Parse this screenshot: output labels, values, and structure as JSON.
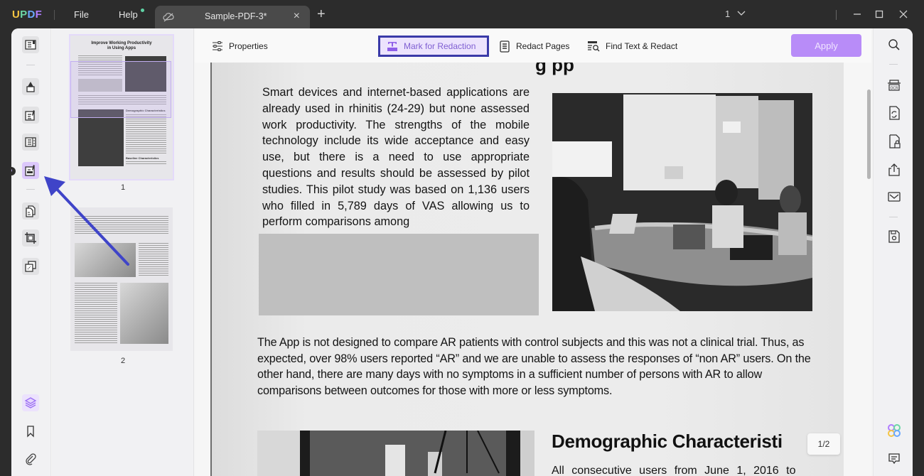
{
  "app": {
    "logo": "UPDF",
    "logo_letters": [
      "U",
      "P",
      "D",
      "F"
    ]
  },
  "menu": {
    "file": "File",
    "help": "Help"
  },
  "tab": {
    "title": "Sample-PDF-3*",
    "close": "×",
    "add": "+"
  },
  "window": {
    "page_selector": "1",
    "minimize": "minimize",
    "maximize": "maximize",
    "close": "close"
  },
  "toolbar": {
    "properties": "Properties",
    "mark_for_redaction": "Mark for Redaction",
    "redact_pages": "Redact Pages",
    "find_text_redact": "Find Text & Redact",
    "apply": "Apply"
  },
  "left_rail": {
    "items": [
      {
        "name": "reader",
        "icon": "book-icon"
      },
      {
        "name": "comment",
        "icon": "highlighter-icon"
      },
      {
        "name": "edit",
        "icon": "edit-pdf-icon"
      },
      {
        "name": "form",
        "icon": "form-icon"
      },
      {
        "name": "redact",
        "icon": "redact-icon",
        "active": true
      },
      {
        "name": "organize",
        "icon": "organize-pages-icon"
      },
      {
        "name": "crop",
        "icon": "crop-icon"
      },
      {
        "name": "combine",
        "icon": "combine-icon"
      }
    ],
    "bottom": [
      {
        "name": "layers",
        "icon": "layers-icon"
      },
      {
        "name": "bookmark",
        "icon": "bookmark-icon"
      },
      {
        "name": "attachment",
        "icon": "paperclip-icon"
      }
    ]
  },
  "thumbnails": [
    {
      "page": "1",
      "title_line1": "Improve Working Productivity",
      "title_line2": "in Using Apps",
      "heading_a": "Demographic Characteristics",
      "heading_b": "Baseline Characteristics"
    },
    {
      "page": "2"
    }
  ],
  "document": {
    "top_fragment": "g  pp",
    "paragraph1": "Smart devices and internet-based applications are already used in rhinitis (24-29) but none assessed work productivity. The strengths of the mobile technology include its wide acceptance and easy use, but there is a need to use appropriate questions and results should be assessed by pilot studies. This pilot study was based on 1,136 users who filled in 5,789 days of VAS allowing us to perform comparisons among",
    "paragraph2": "The App is not designed to compare AR patients with control subjects and this was not a clinical trial. Thus, as expected, over 98% users reported “AR” and we are unable to assess the responses of “non AR” users. On the other hand, there are many days with no symptoms in a sufficient number of persons with AR to allow comparisons between outcomes for those with more or less symptoms.",
    "heading": "Demographic Characteristi",
    "paragraph3": "All consecutive users from June 1, 2016 to"
  },
  "page_indicator": "1/2",
  "right_rail": {
    "items": [
      "search-icon",
      "ocr-icon",
      "convert-icon",
      "protect-icon",
      "share-icon",
      "email-icon",
      "save-icon"
    ],
    "bottom": [
      "ai-assistant-icon",
      "comment-list-icon"
    ]
  },
  "colors": {
    "accent": "#b88cf8",
    "highlight_border": "#3a3aa8",
    "redaction_fill": "#bfbfbf",
    "titlebar": "#2c2c2c"
  }
}
